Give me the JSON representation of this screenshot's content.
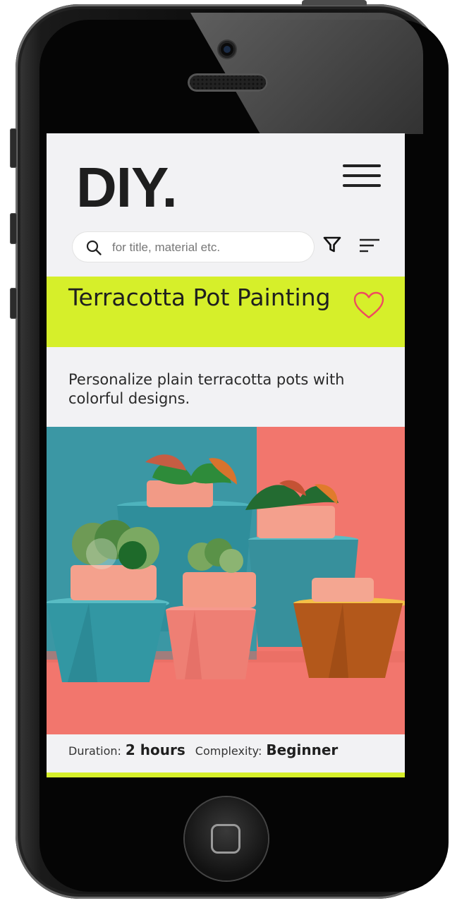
{
  "app": {
    "logo": "DIY."
  },
  "search": {
    "placeholder": "for title, material etc.",
    "value": ""
  },
  "project": {
    "title": "Terracotta Pot Painting",
    "description": "Personalize plain terracotta pots with colorful designs.",
    "duration_label": "Duration:",
    "duration_value": "2 hours",
    "complexity_label": "Complexity:",
    "complexity_value": "Beginner",
    "favorited": false
  },
  "icons": {
    "menu": "hamburger-menu-icon",
    "search": "search-icon",
    "filter": "filter-icon",
    "sort": "sort-icon",
    "favorite": "heart-icon"
  },
  "colors": {
    "accent": "#d6ef2a",
    "heart": "#ef4b5f",
    "screen_bg": "#f2f2f4",
    "text": "#1f1f1f"
  }
}
